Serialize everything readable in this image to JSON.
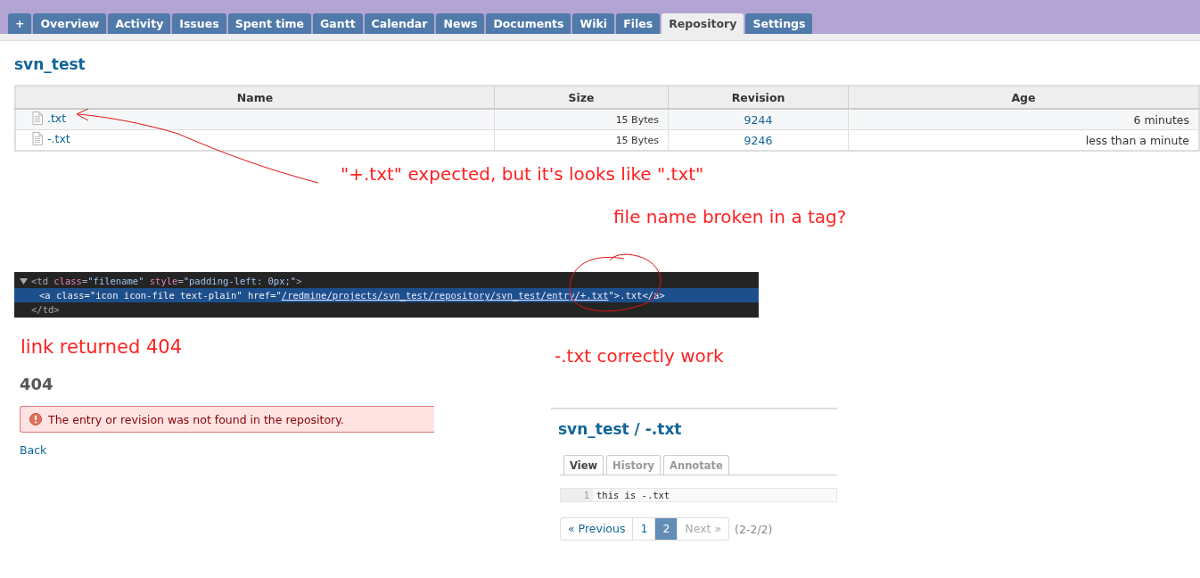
{
  "tabs": [
    {
      "label": "+",
      "selected": false
    },
    {
      "label": "Overview",
      "selected": false
    },
    {
      "label": "Activity",
      "selected": false
    },
    {
      "label": "Issues",
      "selected": false
    },
    {
      "label": "Spent time",
      "selected": false
    },
    {
      "label": "Gantt",
      "selected": false
    },
    {
      "label": "Calendar",
      "selected": false
    },
    {
      "label": "News",
      "selected": false
    },
    {
      "label": "Documents",
      "selected": false
    },
    {
      "label": "Wiki",
      "selected": false
    },
    {
      "label": "Files",
      "selected": false
    },
    {
      "label": "Repository",
      "selected": true
    },
    {
      "label": "Settings",
      "selected": false
    }
  ],
  "project_title": "svn_test",
  "file_table": {
    "columns": [
      "Name",
      "Size",
      "Revision",
      "Age"
    ],
    "rows": [
      {
        "name": ".txt",
        "size": "15 Bytes",
        "revision": "9244",
        "age": "6 minutes"
      },
      {
        "name": "-.txt",
        "size": "15 Bytes",
        "revision": "9246",
        "age": "less than a minute"
      }
    ]
  },
  "annotations": [
    {
      "text": "\"+.txt\" expected, but it's looks like \".txt\""
    },
    {
      "text": "file name broken in a tag?"
    },
    {
      "text": "link returned 404"
    },
    {
      "text": "-.txt correctly work"
    }
  ],
  "code_inspector": {
    "nodes": [
      {
        "expanded": true,
        "selected": false,
        "open": [
          {
            "kind": "punct",
            "text": "<td "
          },
          {
            "kind": "attr",
            "text": "class"
          },
          {
            "kind": "punct",
            "text": "="
          },
          {
            "kind": "value",
            "text": "\"filename\""
          },
          {
            "kind": "attr",
            "text": " style"
          },
          {
            "kind": "punct",
            "text": "="
          },
          {
            "kind": "value",
            "text": "\"padding-left: 0px;\""
          },
          {
            "kind": "punct",
            "text": ">"
          }
        ],
        "children": [
          {
            "selected": true,
            "open": [
              {
                "kind": "punct",
                "text": "<a class=\"icon icon-file text-plain\" href=\""
              },
              {
                "kind": "link",
                "text": "/redmine/projects/svn_test/repository/svn_test/entry/+.txt"
              },
              {
                "kind": "punct",
                "text": "\">.txt</a>"
              }
            ]
          }
        ],
        "close": "</td>"
      }
    ]
  },
  "error_page": {
    "heading": "404",
    "flash": "The entry or revision was not found in the repository.",
    "back_link": "Back"
  },
  "file_view": {
    "title": "svn_test / -.txt",
    "tabs": [
      {
        "label": "View",
        "selected": true
      },
      {
        "label": "History",
        "selected": false
      },
      {
        "label": "Annotate",
        "selected": false
      }
    ],
    "lines": [
      {
        "number": "1",
        "text": "this is -.txt"
      }
    ],
    "pagination": {
      "items": [
        {
          "label": "« Previous",
          "selected": false,
          "disabled": false
        },
        {
          "label": "1",
          "selected": false,
          "disabled": false
        },
        {
          "label": "2",
          "selected": true,
          "disabled": false
        },
        {
          "label": "Next »",
          "selected": false,
          "disabled": true
        }
      ],
      "range": "(2-2/2)"
    }
  }
}
